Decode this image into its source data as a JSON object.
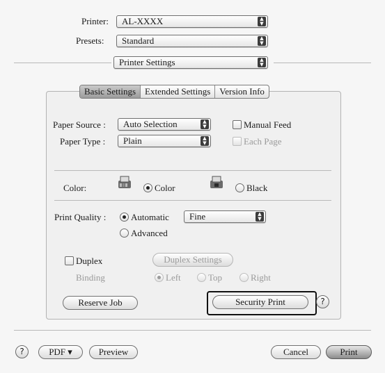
{
  "header": {
    "printer_label": "Printer:",
    "printer_value": "AL-XXXX",
    "presets_label": "Presets:",
    "presets_value": "Standard",
    "panel_value": "Printer Settings"
  },
  "tabs": [
    {
      "label": "Basic Settings",
      "active": true
    },
    {
      "label": "Extended Settings",
      "active": false
    },
    {
      "label": "Version Info",
      "active": false
    }
  ],
  "paper": {
    "source_label": "Paper Source :",
    "source_value": "Auto Selection",
    "type_label": "Paper Type :",
    "type_value": "Plain",
    "manual_feed_label": "Manual Feed",
    "each_page_label": "Each Page"
  },
  "color": {
    "label": "Color:",
    "color_option": "Color",
    "black_option": "Black",
    "selected": "Color"
  },
  "quality": {
    "label": "Print Quality :",
    "automatic_label": "Automatic",
    "advanced_label": "Advanced",
    "level_value": "Fine"
  },
  "duplex": {
    "label": "Duplex",
    "settings_button": "Duplex Settings",
    "binding_label": "Binding",
    "left_label": "Left",
    "top_label": "Top",
    "right_label": "Right"
  },
  "actions": {
    "reserve_job": "Reserve Job",
    "security_print": "Security Print"
  },
  "footer": {
    "help_glyph": "?",
    "pdf_label": "PDF ▾",
    "preview_label": "Preview",
    "cancel_label": "Cancel",
    "print_label": "Print"
  },
  "popup_arrows": "▲▼"
}
